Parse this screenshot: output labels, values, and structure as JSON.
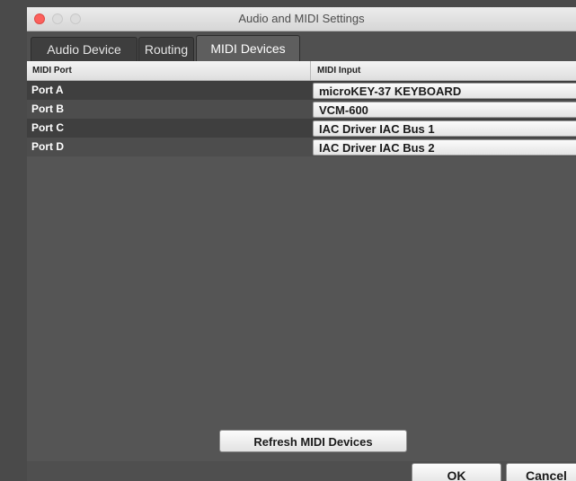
{
  "window": {
    "title": "Audio and MIDI Settings"
  },
  "tabs": [
    {
      "label": "Audio Device",
      "active": false
    },
    {
      "label": "Routing",
      "active": false
    },
    {
      "label": "MIDI Devices",
      "active": true
    }
  ],
  "table": {
    "columns": [
      "MIDI Port",
      "MIDI Input"
    ],
    "rows": [
      {
        "port": "Port A",
        "input": "microKEY-37 KEYBOARD"
      },
      {
        "port": "Port B",
        "input": "VCM-600"
      },
      {
        "port": "Port C",
        "input": "IAC Driver IAC Bus 1"
      },
      {
        "port": "Port D",
        "input": "IAC Driver IAC Bus 2"
      }
    ]
  },
  "buttons": {
    "refresh": "Refresh MIDI Devices",
    "ok": "OK",
    "cancel": "Cancel"
  },
  "colors": {
    "close_button": "#fc605c",
    "panel_bg": "#555555"
  }
}
